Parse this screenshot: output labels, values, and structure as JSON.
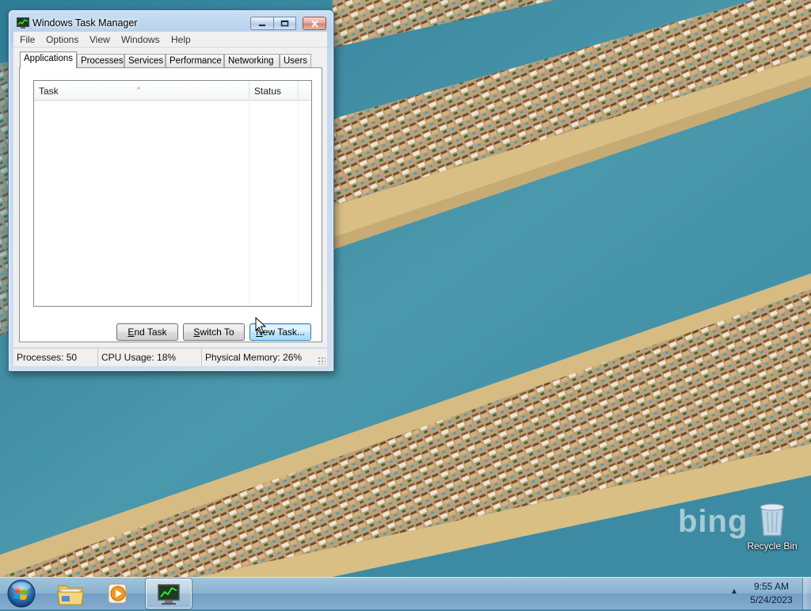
{
  "window": {
    "title": "Windows Task Manager",
    "menu": [
      "File",
      "Options",
      "View",
      "Windows",
      "Help"
    ],
    "tabs": [
      "Applications",
      "Processes",
      "Services",
      "Performance",
      "Networking",
      "Users"
    ],
    "active_tab": "Applications",
    "list_columns": [
      "Task",
      "Status"
    ],
    "buttons": {
      "end_task": "End Task",
      "switch_to": "Switch To",
      "new_task": "New Task..."
    },
    "status": {
      "processes": "Processes: 50",
      "cpu": "CPU Usage: 18%",
      "memory": "Physical Memory: 26%"
    }
  },
  "desktop": {
    "icons": [
      {
        "label": "Recycle Bin",
        "icon": "recycle-bin-icon"
      }
    ],
    "watermark": "bing"
  },
  "taskbar": {
    "pinned": [
      {
        "icon": "windows-explorer-icon"
      },
      {
        "icon": "media-player-icon"
      },
      {
        "icon": "task-manager-icon",
        "active": true
      }
    ],
    "clock": {
      "time": "9:55 AM",
      "date": "5/24/2023"
    }
  },
  "colors": {
    "window_frame": "#c4d9ee",
    "taskbar": "#9bbad8",
    "sea": "#3e8fa7",
    "sand": "#d9bf84",
    "focus_button": "#bee6fd"
  }
}
